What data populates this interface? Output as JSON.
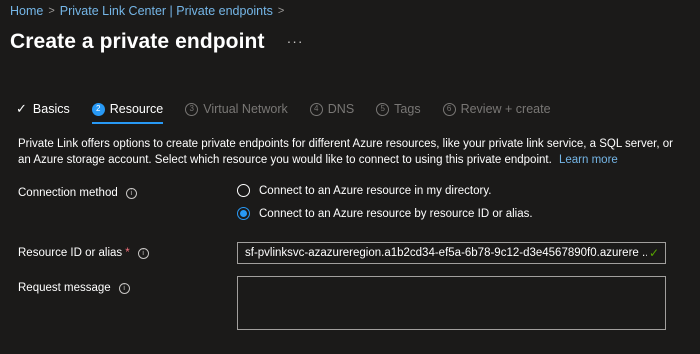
{
  "breadcrumb": {
    "home": "Home",
    "parent": "Private Link Center | Private endpoints",
    "separator": ">"
  },
  "page": {
    "title": "Create a private endpoint",
    "more": "···"
  },
  "tabs": [
    {
      "label": "Basics",
      "state": "done",
      "icon": "checkmark-icon"
    },
    {
      "label": "Resource",
      "state": "active",
      "number": "2"
    },
    {
      "label": "Virtual Network",
      "state": "disabled",
      "number": "3"
    },
    {
      "label": "DNS",
      "state": "disabled",
      "number": "4"
    },
    {
      "label": "Tags",
      "state": "disabled",
      "number": "5"
    },
    {
      "label": "Review + create",
      "state": "disabled",
      "number": "6"
    }
  ],
  "description": {
    "text": "Private Link offers options to create private endpoints for different Azure resources, like your private link service, a SQL server, or an Azure storage account. Select which resource you would like to connect to using this private endpoint.",
    "link": "Learn more"
  },
  "form": {
    "connection_method": {
      "label": "Connection method",
      "info": "i",
      "options": [
        {
          "label": "Connect to an Azure resource in my directory.",
          "selected": false
        },
        {
          "label": "Connect to an Azure resource by resource ID or alias.",
          "selected": true
        }
      ]
    },
    "resource_id": {
      "label": "Resource ID or alias",
      "required": "*",
      "info": "i",
      "value": "sf-pvlinksvc-azazureregion.a1b2cd34-ef5a-6b78-9c12-d3e4567890f0.azurere ...",
      "valid": "✓"
    },
    "request_message": {
      "label": "Request message",
      "info": "i",
      "value": ""
    }
  },
  "colors": {
    "background": "#1b1a19",
    "link": "#75b6e7",
    "accent": "#2899f5",
    "required": "#f1707b",
    "valid": "#57a300",
    "disabled": "#797775"
  }
}
